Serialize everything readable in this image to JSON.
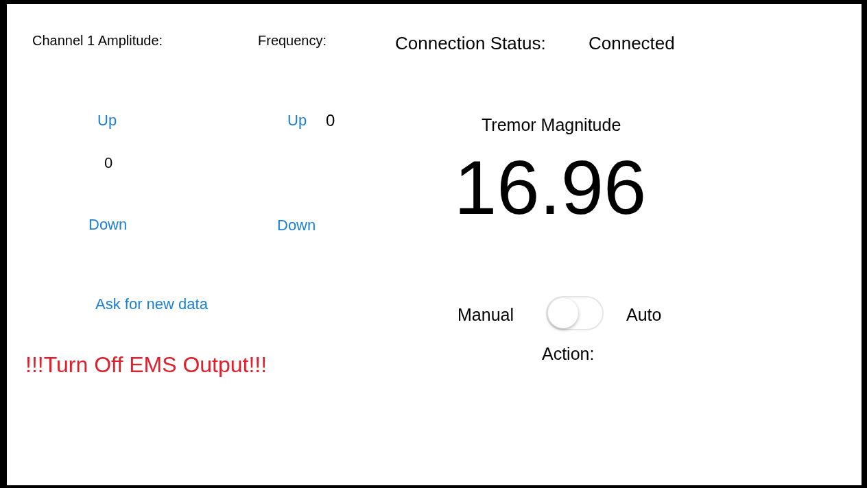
{
  "amplitude": {
    "label": "Channel 1 Amplitude:",
    "up": "Up",
    "value": "0",
    "down": "Down"
  },
  "frequency": {
    "label": "Frequency:",
    "up": "Up",
    "value": "0",
    "down": "Down"
  },
  "connection": {
    "label": "Connection Status:",
    "value": "Connected"
  },
  "tremor": {
    "label": "Tremor Magnitude",
    "value": "16.96"
  },
  "ask_button": "Ask for new data",
  "warning": "!!!Turn Off EMS Output!!!",
  "mode": {
    "left_label": "Manual",
    "right_label": "Auto",
    "on": false
  },
  "action_label": "Action:"
}
